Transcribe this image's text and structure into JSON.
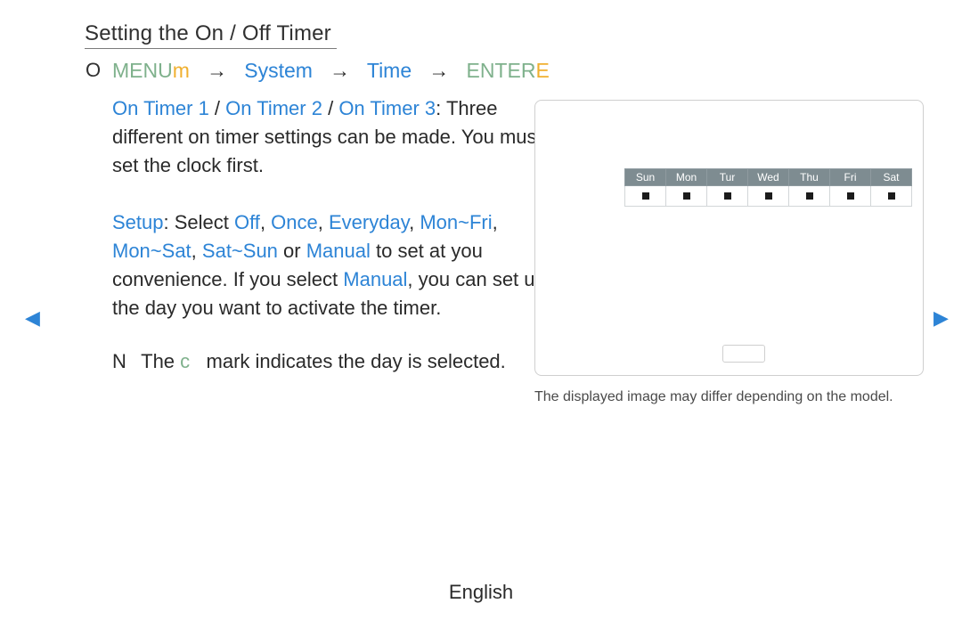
{
  "heading": "Setting the On / Off Timer",
  "breadcrumb": {
    "bullet": "O",
    "menu": "MENU",
    "m_glyph": "m",
    "system": "System",
    "time": "Time",
    "enter_word": "ENTER",
    "enter_glyph": "E",
    "arrow": "→"
  },
  "para1": {
    "t1": "On Timer 1",
    "sep1": " / ",
    "t2": "On Timer 2",
    "sep2": " / ",
    "t3": "On Timer 3",
    "colon": ": ",
    "rest": "Three different on timer settings can be made. You must set the clock first."
  },
  "para2": {
    "setup": "Setup",
    "after_setup": ": Select ",
    "off": "Off",
    "c1": ", ",
    "once": "Once",
    "c2": ", ",
    "everyday": "Everyday",
    "c3": ", ",
    "monfri": "Mon~Fri",
    "c4": ", ",
    "monsat": "Mon~Sat",
    "c5": ", ",
    "satsun": "Sat~Sun",
    "or": " or ",
    "manual": "Manual",
    "tail1": " to set at you convenience. If you select ",
    "manual2": "Manual",
    "tail2": ", you can set up the day you want to activate the timer."
  },
  "note": {
    "bullet": "N",
    "pre": "The ",
    "c_glyph": "c",
    "post": " mark indicates the day is selected."
  },
  "days": [
    "Sun",
    "Mon",
    "Tur",
    "Wed",
    "Thu",
    "Fri",
    "Sat"
  ],
  "caption": "The displayed image may differ depending on the model.",
  "side_nav": {
    "left": "◀",
    "right": "▶"
  },
  "footer": "English"
}
